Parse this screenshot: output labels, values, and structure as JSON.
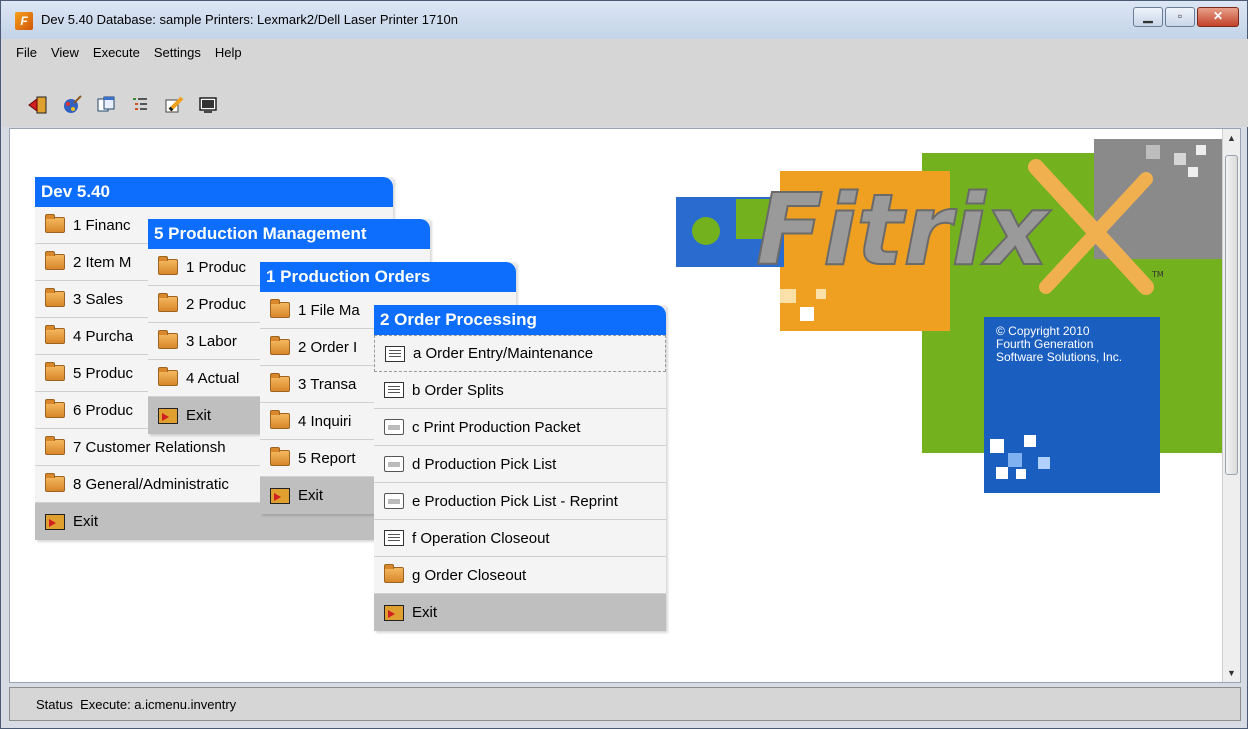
{
  "window": {
    "title": "Dev 5.40 Database: sample Printers: Lexmark2/Dell Laser Printer 1710n",
    "app_icon_letter": "F"
  },
  "menubar": {
    "items": [
      "File",
      "View",
      "Execute",
      "Settings",
      "Help"
    ]
  },
  "toolbar": {
    "icons": [
      "exit-icon",
      "paint-icon",
      "windows-icon",
      "list-icon",
      "edit-icon",
      "screen-icon"
    ]
  },
  "menus": {
    "dev": {
      "title": "Dev 5.40",
      "items": [
        "1 Financ",
        "2 Item M",
        "3 Sales",
        "4 Purcha",
        "5 Produc",
        "6 Produc",
        "7 Customer Relationsh",
        "8 General/Administratic"
      ],
      "exit": "Exit"
    },
    "production_management": {
      "title": "5 Production Management",
      "items": [
        "1 Produc",
        "2 Produc",
        "3 Labor",
        "4 Actual"
      ],
      "exit": "Exit"
    },
    "production_orders": {
      "title": "1 Production Orders",
      "items": [
        "1 File Ma",
        "2 Order I",
        "3 Transa",
        "4 Inquiri",
        "5 Report"
      ],
      "exit": "Exit"
    },
    "order_processing": {
      "title": "2 Order Processing",
      "items": [
        {
          "label": "a Order Entry/Maintenance",
          "icon": "screen"
        },
        {
          "label": "b Order Splits",
          "icon": "screen"
        },
        {
          "label": "c Print Production Packet",
          "icon": "printer"
        },
        {
          "label": "d Production Pick List",
          "icon": "printer"
        },
        {
          "label": "e Production Pick List - Reprint",
          "icon": "printer"
        },
        {
          "label": "f Operation Closeout",
          "icon": "screen"
        },
        {
          "label": "g Order Closeout",
          "icon": "folder"
        }
      ],
      "exit": "Exit"
    }
  },
  "logo": {
    "brand": "Fitrix",
    "trademark": "TM",
    "copyright_lines": [
      "© Copyright 2010",
      "Fourth Generation",
      "Software Solutions, Inc."
    ],
    "colors": {
      "green": "#73b21e",
      "orange": "#f0a020",
      "blue": "#1a5fc0",
      "gray": "#8a8a8a",
      "puzzle_blue": "#2a6bd0"
    }
  },
  "status": {
    "label": "Status",
    "text": "Execute: a.icmenu.inventry"
  }
}
